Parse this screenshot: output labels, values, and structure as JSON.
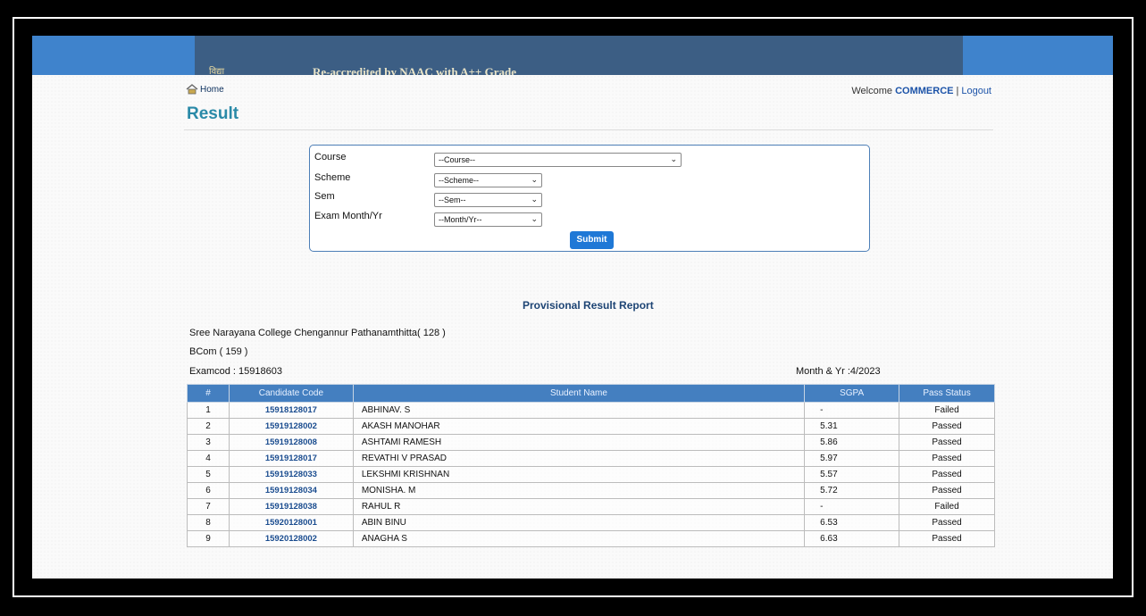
{
  "header": {
    "banner_text": "Re-accredited by NAAC with A++ Grade",
    "motto": "विद्या",
    "home_label": "Home",
    "welcome_text": "Welcome",
    "user": "COMMERCE",
    "separator": "|",
    "logout_label": "Logout"
  },
  "page": {
    "title": "Result"
  },
  "form": {
    "fields": [
      {
        "label": "Course",
        "value": "--Course--"
      },
      {
        "label": "Scheme",
        "value": "--Scheme--"
      },
      {
        "label": "Sem",
        "value": "--Sem--"
      },
      {
        "label": "Exam Month/Yr",
        "value": "--Month/Yr--"
      }
    ],
    "submit_label": "Submit",
    "chevron": "⌄"
  },
  "report": {
    "title": "Provisional Result Report",
    "college": "Sree Narayana College Chengannur Pathanamthitta( 128 )",
    "course": "BCom ( 159 )",
    "examcode": "Examcod : 15918603",
    "month_year": "Month & Yr :4/2023"
  },
  "table": {
    "headers": [
      "#",
      "Candidate Code",
      "Student Name",
      "SGPA",
      "Pass Status"
    ],
    "rows": [
      [
        "1",
        "15918128017",
        "ABHINAV. S",
        "-",
        "Failed"
      ],
      [
        "2",
        "15919128002",
        "AKASH MANOHAR",
        "5.31",
        "Passed"
      ],
      [
        "3",
        "15919128008",
        "ASHTAMI RAMESH",
        "5.86",
        "Passed"
      ],
      [
        "4",
        "15919128017",
        "REVATHI V PRASAD",
        "5.97",
        "Passed"
      ],
      [
        "5",
        "15919128033",
        "LEKSHMI KRISHNAN",
        "5.57",
        "Passed"
      ],
      [
        "6",
        "15919128034",
        "MONISHA. M",
        "5.72",
        "Passed"
      ],
      [
        "7",
        "15919128038",
        "RAHUL R",
        "-",
        "Failed"
      ],
      [
        "8",
        "15920128001",
        "ABIN BINU",
        "6.53",
        "Passed"
      ],
      [
        "9",
        "15920128002",
        "ANAGHA S",
        "6.63",
        "Passed"
      ]
    ]
  },
  "colors": {
    "banner": "#3f83cc",
    "header_row": "#447fc0",
    "title": "#2a8aa8",
    "link": "#1a4c8f"
  }
}
